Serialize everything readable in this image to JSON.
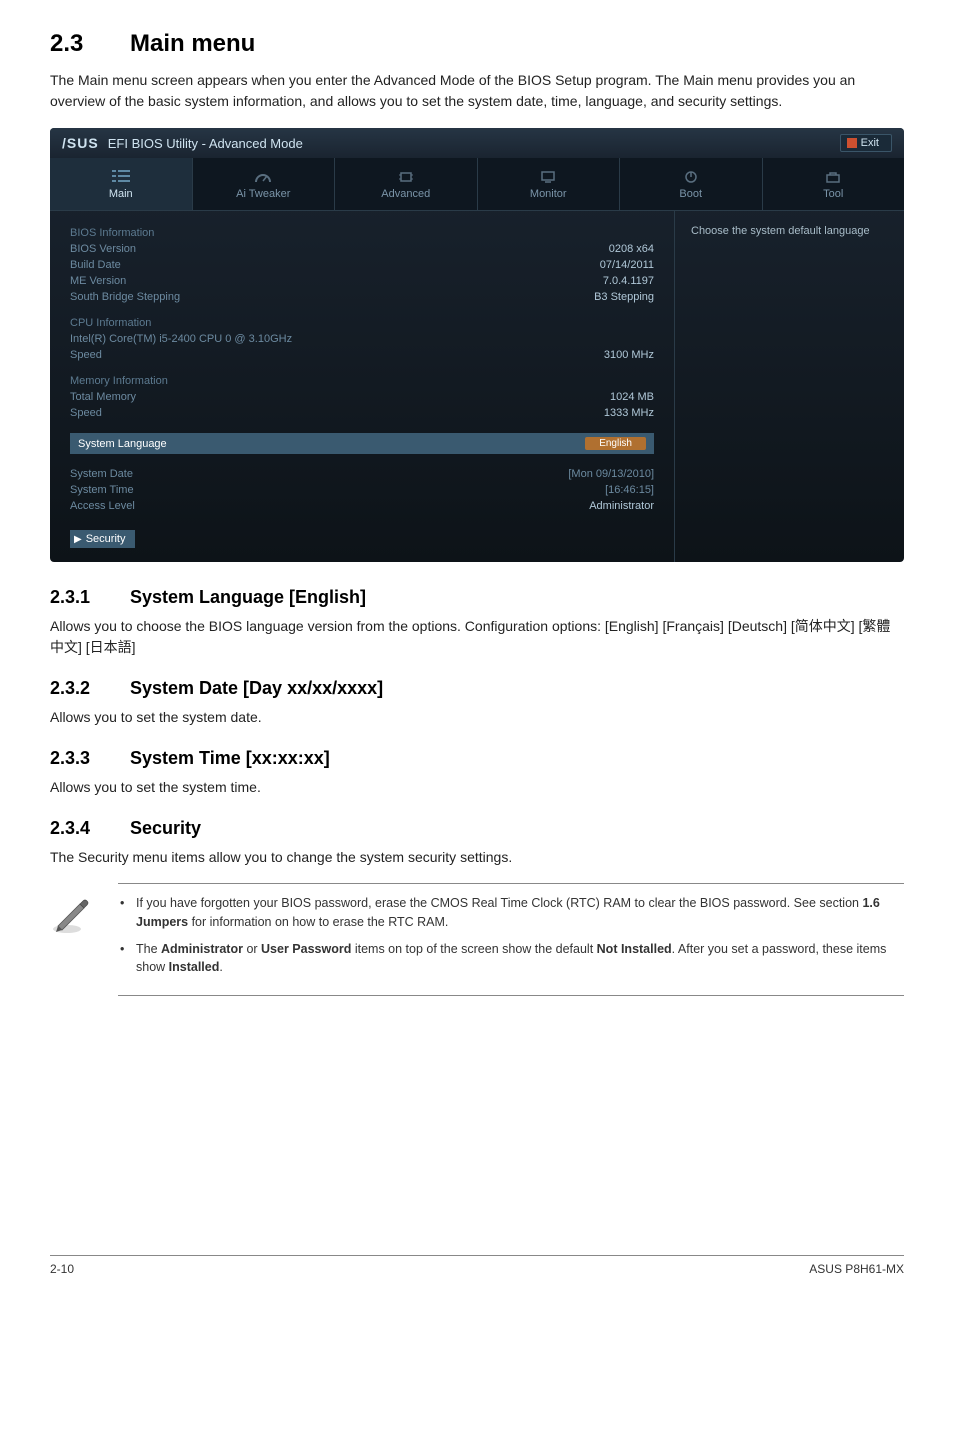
{
  "heading": {
    "num": "2.3",
    "title": "Main menu"
  },
  "intro": "The Main menu screen appears when you enter the Advanced Mode of the BIOS Setup program. The Main menu provides you an overview of the basic system information, and allows you to set the system date, time, language, and security settings.",
  "bios": {
    "logo": "/SUS",
    "title": "EFI BIOS Utility - Advanced Mode",
    "exit": "Exit",
    "tabs": {
      "main": "Main",
      "tweaker": "Ai Tweaker",
      "advanced": "Advanced",
      "monitor": "Monitor",
      "boot": "Boot",
      "tool": "Tool"
    },
    "side_text": "Choose the system default language",
    "info": {
      "bios_information": "BIOS Information",
      "bios_version_label": "BIOS Version",
      "bios_version_value": "0208 x64",
      "build_date_label": "Build Date",
      "build_date_value": "07/14/2011",
      "me_version_label": "ME Version",
      "me_version_value": "7.0.4.1197",
      "south_bridge_label": "South Bridge Stepping",
      "south_bridge_value": "B3 Stepping",
      "cpu_information": "CPU Information",
      "cpu_model": "Intel(R) Core(TM) i5-2400 CPU 0 @ 3.10GHz",
      "cpu_speed_label": "Speed",
      "cpu_speed_value": "3100 MHz",
      "memory_information": "Memory Information",
      "total_memory_label": "Total Memory",
      "total_memory_value": "1024 MB",
      "mem_speed_label": "Speed",
      "mem_speed_value": "1333 MHz",
      "system_language_label": "System Language",
      "system_language_value": "English",
      "system_date_label": "System Date",
      "system_date_value": "[Mon 09/13/2010]",
      "system_time_label": "System Time",
      "system_time_value": "[16:46:15]",
      "access_level_label": "Access Level",
      "access_level_value": "Administrator",
      "security": "Security"
    }
  },
  "sub1": {
    "num": "2.3.1",
    "title": "System Language [English]",
    "text": "Allows you to choose the BIOS language version from the options. Configuration options: [English] [Français] [Deutsch] [简体中文] [繁體中文] [日本語]"
  },
  "sub2": {
    "num": "2.3.2",
    "title": "System Date [Day xx/xx/xxxx]",
    "text": "Allows you to set the system date."
  },
  "sub3": {
    "num": "2.3.3",
    "title": "System Time [xx:xx:xx]",
    "text": "Allows you to set the system time."
  },
  "sub4": {
    "num": "2.3.4",
    "title": "Security",
    "text": "The Security menu items allow you to change the system security settings."
  },
  "notes": {
    "item1_a": "If you have forgotten your BIOS password, erase the CMOS Real Time Clock (RTC) RAM to clear the BIOS password. See section ",
    "item1_b": "1.6 Jumpers",
    "item1_c": " for information on how to erase the RTC RAM.",
    "item2_a": "The ",
    "item2_b": "Administrator",
    "item2_c": " or ",
    "item2_d": "User Password",
    "item2_e": " items on top of the screen show the default ",
    "item2_f": "Not Installed",
    "item2_g": ". After you set a password, these items show ",
    "item2_h": "Installed",
    "item2_i": "."
  },
  "footer": {
    "left": "2-10",
    "right": "ASUS P8H61-MX"
  }
}
